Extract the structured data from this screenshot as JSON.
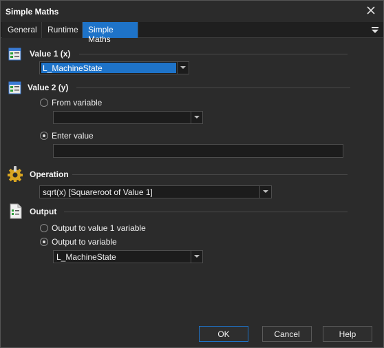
{
  "window": {
    "title": "Simple Maths"
  },
  "tabs": [
    {
      "label": "General"
    },
    {
      "label": "Runtime"
    },
    {
      "label": "Simple Maths"
    }
  ],
  "value1": {
    "label": "Value 1 (x)",
    "selected": "L_MachineState"
  },
  "value2": {
    "label": "Value 2 (y)",
    "from_variable_label": "From variable",
    "from_variable_value": "",
    "enter_value_label": "Enter value",
    "enter_value_text": "",
    "selected_option": "Enter value"
  },
  "operation": {
    "label": "Operation",
    "selected": "sqrt(x)  [Squareroot of Value 1]"
  },
  "output": {
    "label": "Output",
    "option1_label": "Output to value 1 variable",
    "option2_label": "Output to variable",
    "selected_option": "Output to variable",
    "variable": "L_MachineState"
  },
  "buttons": {
    "ok": "OK",
    "cancel": "Cancel",
    "help": "Help"
  },
  "colors": {
    "accent": "#1e73c8",
    "background": "#2b2b2b",
    "field": "#1c1c1c"
  }
}
